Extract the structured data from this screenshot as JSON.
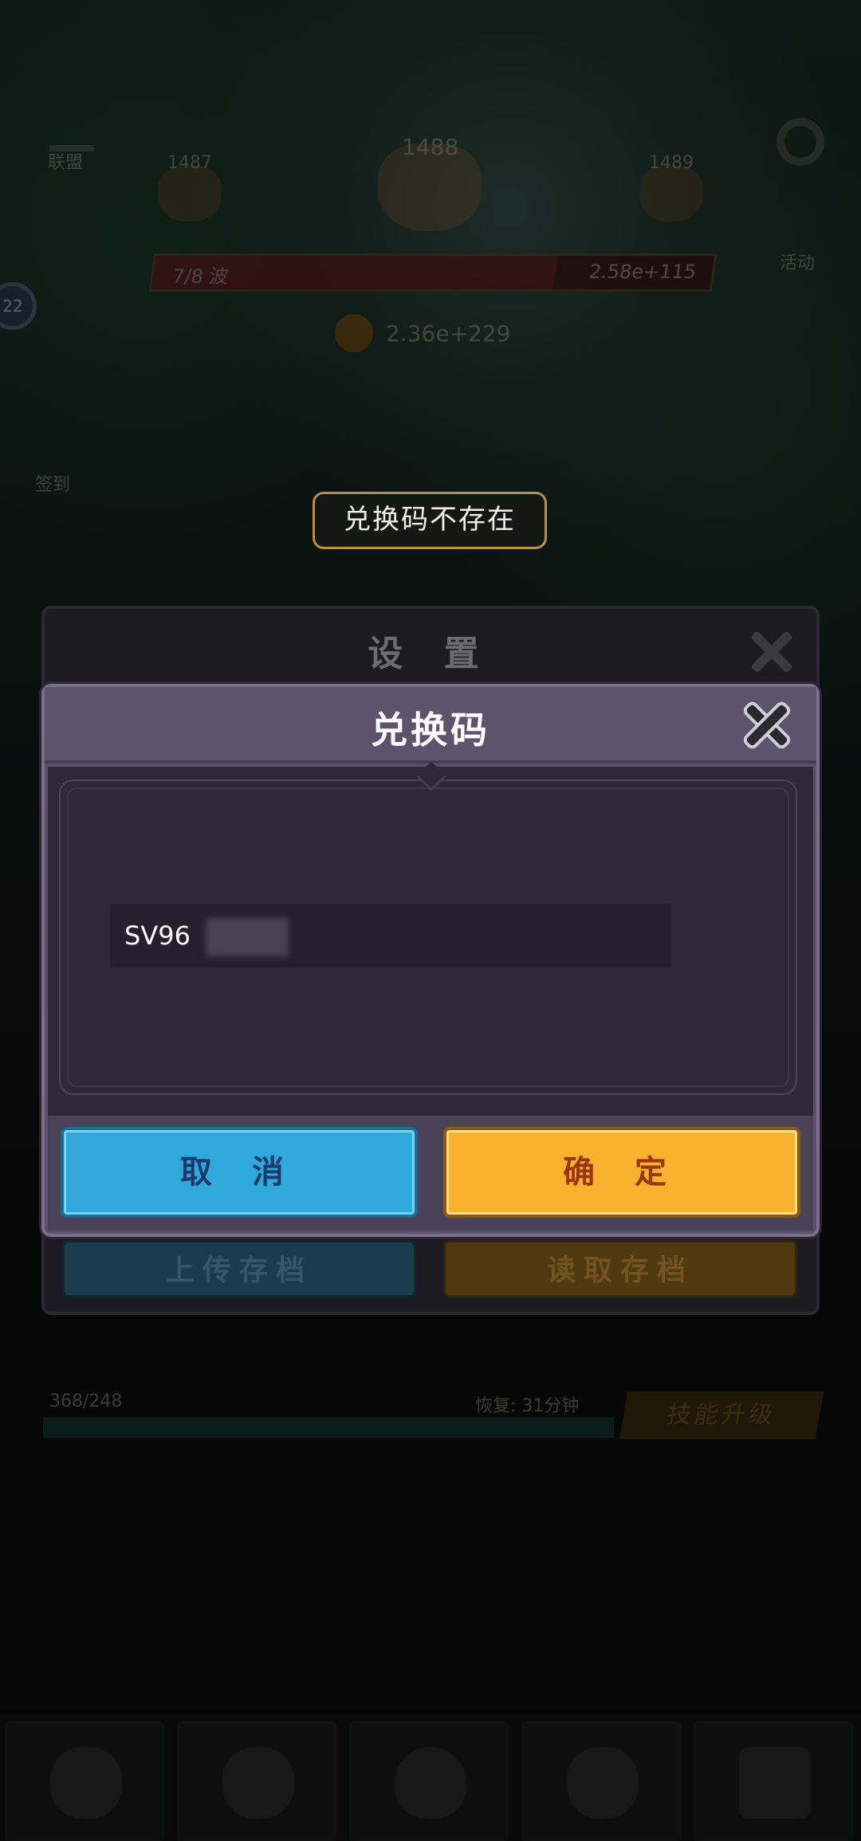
{
  "hud": {
    "crown_label": "联盟",
    "stage_prev": "1487",
    "stage_current": "1488",
    "stage_next": "1489",
    "hp_left": "7/8 波",
    "hp_right": "2.58e+115",
    "coins": "2.36e+229",
    "side_badge": "22",
    "side_label": "签到",
    "right_label": "活动"
  },
  "toast": {
    "message": "兑换码不存在"
  },
  "settings": {
    "title": "设 置",
    "upload_button": "上传存档",
    "read_button": "读取存档"
  },
  "redeem": {
    "title": "兑换码",
    "code_value": "SV96",
    "cancel_label": "取 消",
    "confirm_label": "确 定"
  },
  "bottom": {
    "energy_text": "368/248",
    "recovery_text": "恢复: 31分钟",
    "skill_upgrade": "技能升级"
  },
  "icons": [
    "crown-icon",
    "skull-icon",
    "gear-icon",
    "coin-icon",
    "close-icon",
    "helmet-icon",
    "shield-sword-icon",
    "egg-icon",
    "armor-icon",
    "chest-icon"
  ]
}
